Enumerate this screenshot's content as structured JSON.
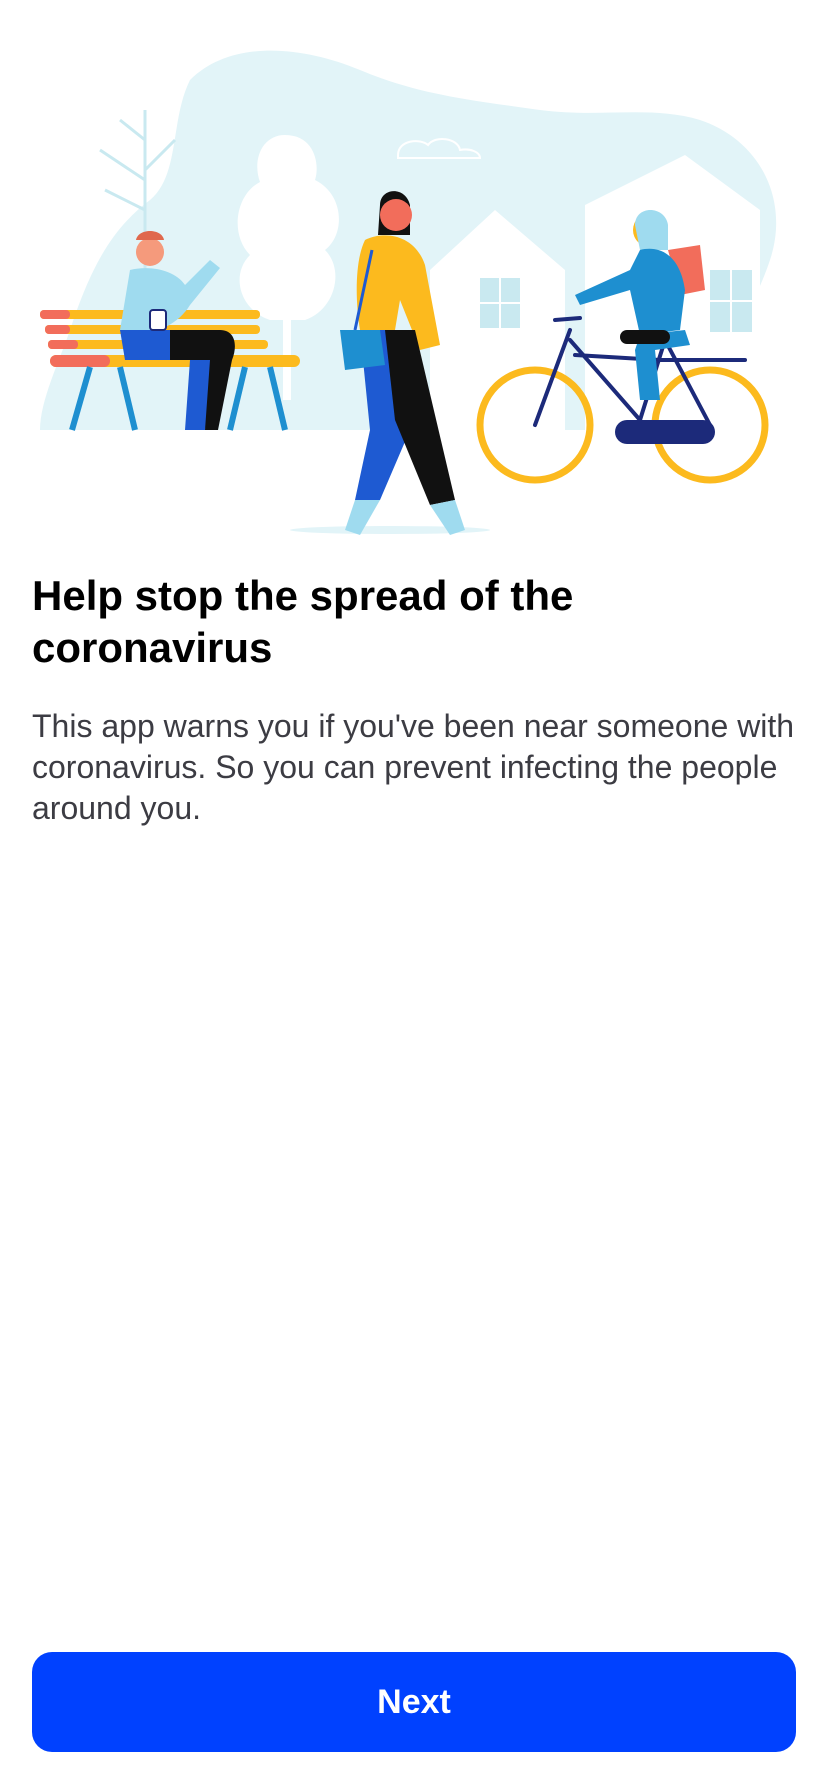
{
  "onboarding": {
    "title": "Help stop the spread of the coronavirus",
    "body": "This app warns you if you've been near someone with coronavirus. So you can prevent infecting the people around you.",
    "next_label": "Next"
  },
  "illustration": {
    "icon": "people-outdoors-illustration",
    "colors": {
      "background_blob": "#e2f4f8",
      "accent_yellow": "#fcba1e",
      "accent_blue": "#1e5ad2",
      "accent_coral": "#f26d5b",
      "navy": "#1c2a7a"
    }
  },
  "theme": {
    "primary": "#0041ff",
    "text_primary": "#000000",
    "text_secondary": "#3c3c43",
    "background": "#ffffff"
  }
}
